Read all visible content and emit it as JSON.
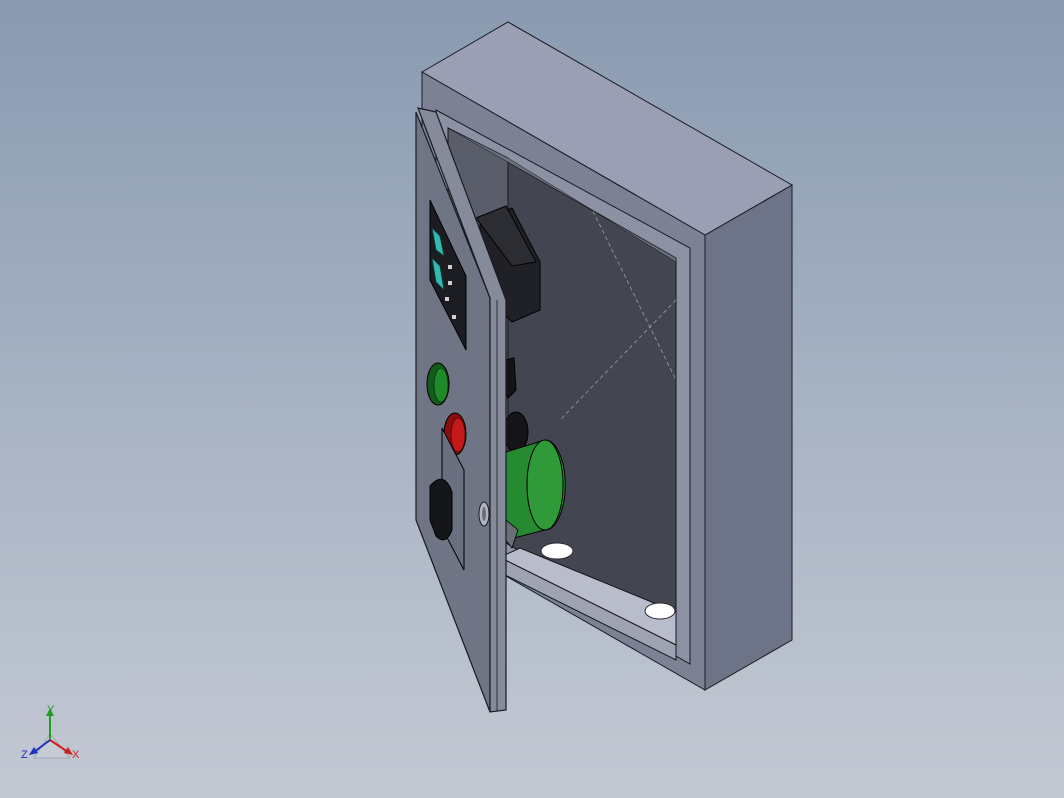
{
  "viewport": {
    "background_top": "#8a9ab0",
    "background_bottom": "#c3c9d3"
  },
  "model": {
    "enclosure_color": "#6e7487",
    "enclosure_top_color": "#9a9fb4",
    "interior_color": "#434650",
    "door_color": "#6f7584",
    "pilot_light_green": "#1f8a2a",
    "pilot_light_red": "#c41a1a",
    "selector_color": "#15161a",
    "indicator_color": "#35b8b0"
  },
  "triad": {
    "x_label": "X",
    "y_label": "Y",
    "z_label": "Z",
    "x_color": "#d02020",
    "y_color": "#20a020",
    "z_color": "#2030c0"
  }
}
